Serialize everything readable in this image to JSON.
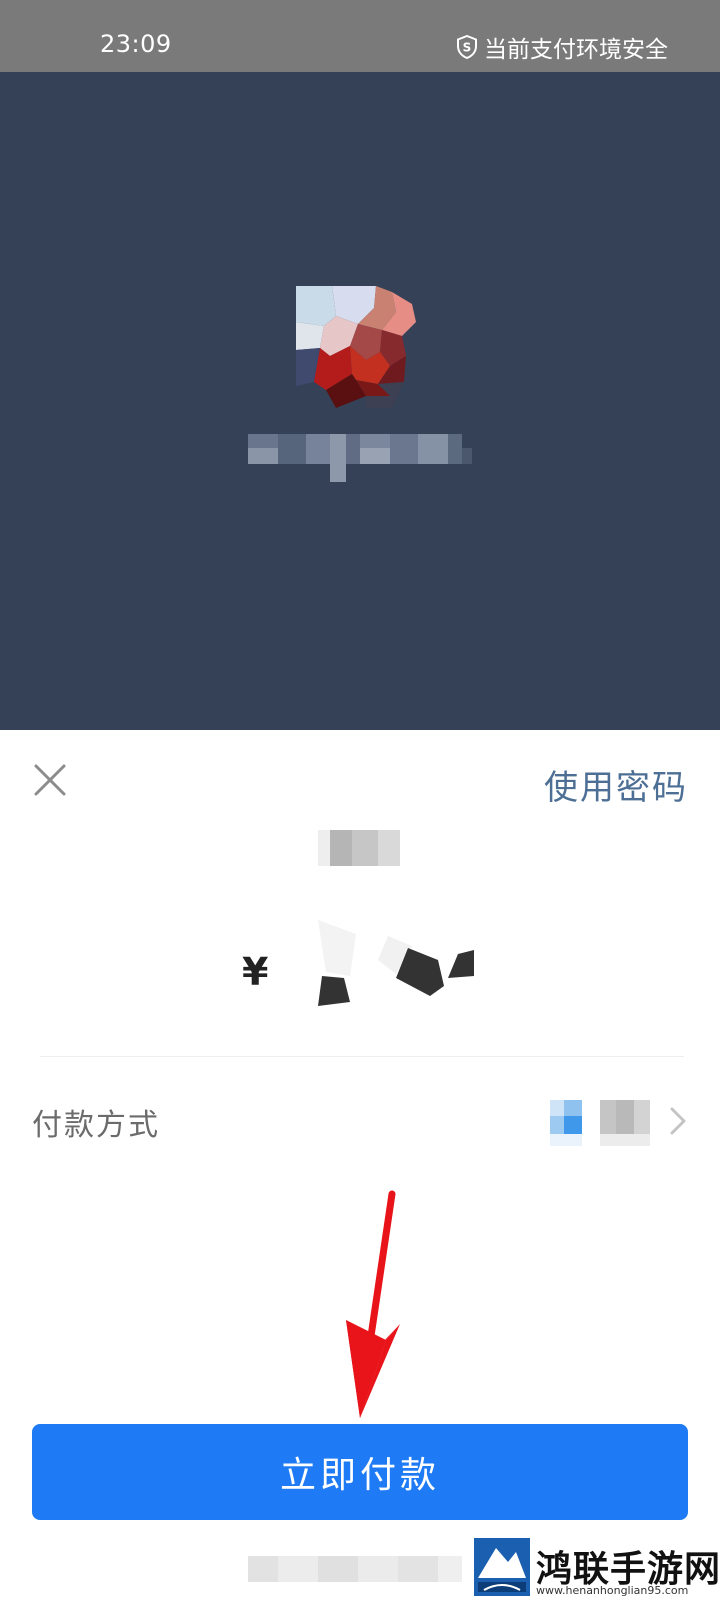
{
  "status_bar": {
    "time": "23:09",
    "security_text": "当前支付环境安全"
  },
  "payment_sheet": {
    "use_password_label": "使用密码",
    "currency_symbol": "¥",
    "payment_method_label": "付款方式",
    "pay_button_label": "立即付款"
  },
  "watermark": {
    "name": "鸿联手游网",
    "url": "www.henanhonglian95.com"
  },
  "colors": {
    "status_bar": "#7a7a7a",
    "header_background": "#354157",
    "primary_button": "#1f7bf5",
    "link": "#4d6f95",
    "annotation_arrow": "#e8141a"
  },
  "icons": [
    "shield-icon",
    "close-icon",
    "chevron-right-icon",
    "red-arrow-annotation"
  ]
}
